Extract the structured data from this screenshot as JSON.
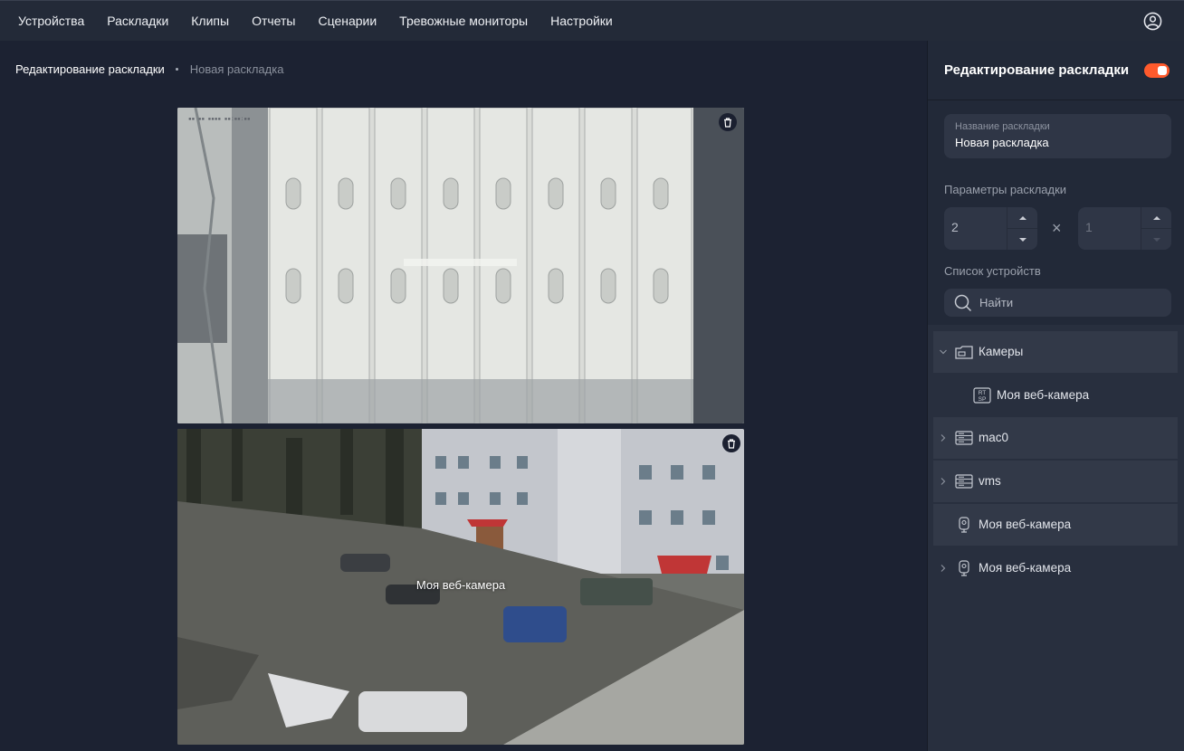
{
  "nav": {
    "items": [
      "Устройства",
      "Раскладки",
      "Клипы",
      "Отчеты",
      "Сценарии",
      "Тревожные мониторы",
      "Настройки"
    ]
  },
  "breadcrumb": {
    "current": "Редактирование раскладки",
    "item": "Новая раскладка"
  },
  "tiles": {
    "tile2_label": "Моя веб-камера"
  },
  "panel": {
    "title": "Редактирование раскладки",
    "toggle_on": true,
    "name_label": "Название раскладки",
    "name_value": "Новая раскладка",
    "params_label": "Параметры раскладки",
    "rows_value": "2",
    "cols_value": "1",
    "times_sign": "×",
    "devices_label": "Список устройств",
    "search_placeholder": "Найти"
  },
  "tree": [
    {
      "label": "Камеры",
      "icon": "folder-camera-icon",
      "expanded": true
    },
    {
      "label": "Моя веб-камера",
      "icon": "rtsp-icon",
      "child": true
    },
    {
      "label": "mac0",
      "icon": "server-icon",
      "expanded": false
    },
    {
      "label": "vms",
      "icon": "server-icon",
      "expanded": false
    },
    {
      "label": "Моя веб-камера",
      "icon": "webcam-icon"
    },
    {
      "label": "Моя веб-камера",
      "icon": "webcam-icon",
      "expanded": false
    }
  ],
  "colors": {
    "accent": "#ff5a2c",
    "background": "#1c2232",
    "panel": "#222938"
  }
}
